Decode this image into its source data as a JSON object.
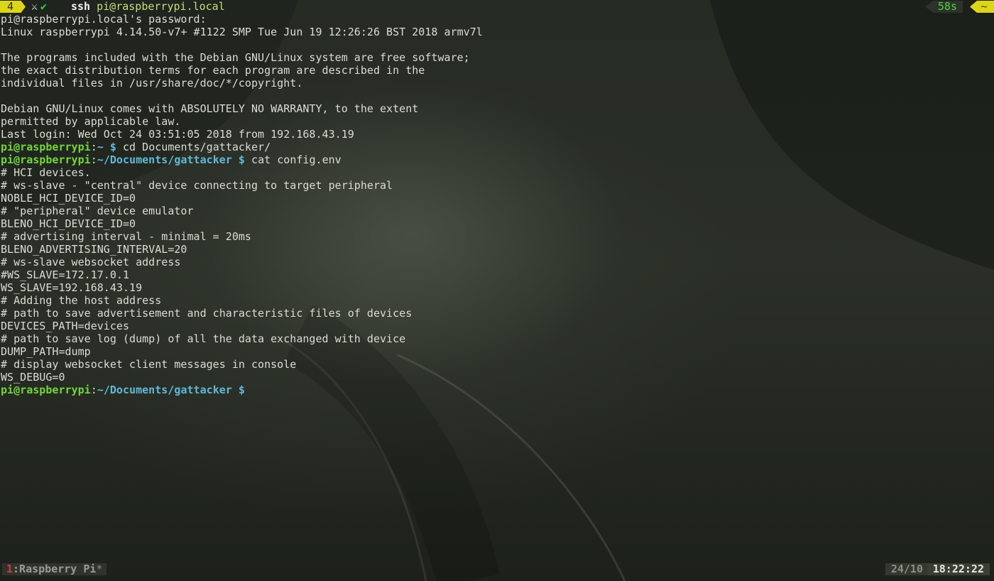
{
  "topbar": {
    "window_number": "4",
    "status_x": "⚔",
    "status_check": "✔",
    "command_bin": "ssh",
    "command_arg": "pi@raspberrypi.local",
    "elapsed": "58s",
    "dir_glyph": "~"
  },
  "terminal": {
    "lines": [
      "pi@raspberrypi.local's password:",
      "Linux raspberrypi 4.14.50-v7+ #1122 SMP Tue Jun 19 12:26:26 BST 2018 armv7l",
      "",
      "The programs included with the Debian GNU/Linux system are free software;",
      "the exact distribution terms for each program are described in the",
      "individual files in /usr/share/doc/*/copyright.",
      "",
      "Debian GNU/Linux comes with ABSOLUTELY NO WARRANTY, to the extent",
      "permitted by applicable law.",
      "Last login: Wed Oct 24 03:51:05 2018 from 192.168.43.19"
    ],
    "prompt1": {
      "user": "pi@raspberrypi",
      "sep": ":",
      "path": "~",
      "symbol": " $",
      "command": " cd Documents/gattacker/"
    },
    "prompt2": {
      "user": "pi@raspberrypi",
      "sep": ":",
      "path": "~/Documents/gattacker",
      "symbol": " $",
      "command": " cat config.env"
    },
    "output": [
      "# HCI devices.",
      "# ws-slave - \"central\" device connecting to target peripheral",
      "NOBLE_HCI_DEVICE_ID=0",
      "# \"peripheral\" device emulator",
      "BLENO_HCI_DEVICE_ID=0",
      "# advertising interval - minimal = 20ms",
      "BLENO_ADVERTISING_INTERVAL=20",
      "# ws-slave websocket address",
      "#WS_SLAVE=172.17.0.1",
      "WS_SLAVE=192.168.43.19",
      "# Adding the host address",
      "# path to save advertisement and characteristic files of devices",
      "DEVICES_PATH=devices",
      "# path to save log (dump) of all the data exchanged with device",
      "DUMP_PATH=dump",
      "# display websocket client messages in console",
      "WS_DEBUG=0"
    ],
    "prompt3": {
      "user": "pi@raspberrypi",
      "sep": ":",
      "path": "~/Documents/gattacker",
      "symbol": " $",
      "command": ""
    }
  },
  "statusbar": {
    "window_index": "1",
    "window_name": ":Raspberry Pi",
    "window_marker": "*",
    "load": "24/10",
    "clock": "18:22:22"
  },
  "colors": {
    "accent_yellow": "#dcd51a",
    "prompt_user": "#74d63b",
    "prompt_path": "#62b8d8",
    "elapsed_green": "#4cd64c",
    "window_index_red": "#d9364a"
  }
}
